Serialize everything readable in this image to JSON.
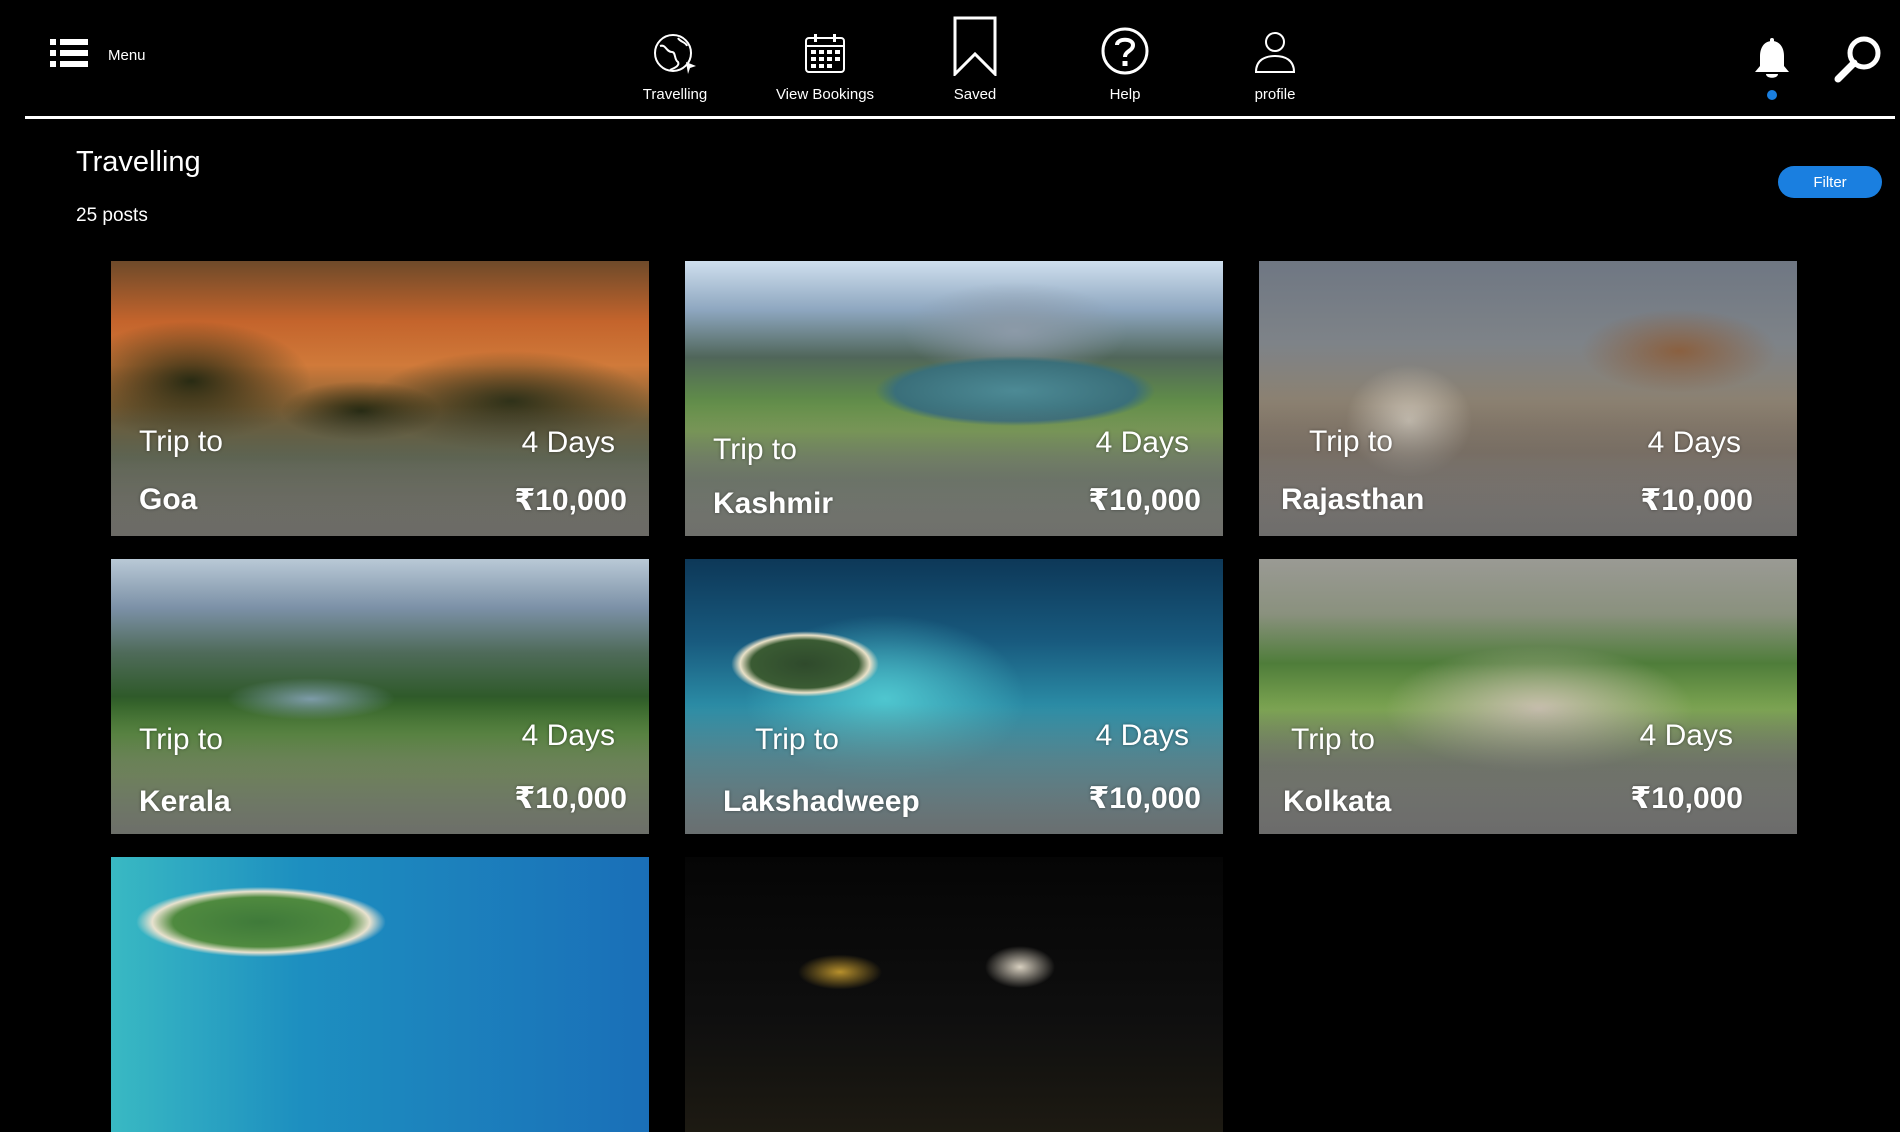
{
  "header": {
    "menu_label": "Menu",
    "nav": [
      {
        "label": "Travelling",
        "icon": "globe-icon"
      },
      {
        "label": "View Bookings",
        "icon": "calendar-icon"
      },
      {
        "label": "Saved",
        "icon": "bookmark-icon"
      },
      {
        "label": "Help",
        "icon": "help-icon"
      },
      {
        "label": "profile",
        "icon": "profile-icon"
      }
    ],
    "notification_icon": "bell-icon",
    "search_icon": "search-icon",
    "accent_color": "#1a7fe0"
  },
  "page": {
    "title": "Travelling",
    "post_count": "25 posts",
    "filter_label": "Filter"
  },
  "cards": [
    {
      "trip_label": "Trip to",
      "place": "Goa",
      "duration": "4 Days",
      "price": "₹10,000"
    },
    {
      "trip_label": "Trip to",
      "place": "Kashmir",
      "duration": "4 Days",
      "price": "₹10,000"
    },
    {
      "trip_label": "Trip to",
      "place": "Rajasthan",
      "duration": "4 Days",
      "price": "₹10,000"
    },
    {
      "trip_label": "Trip to",
      "place": "Kerala",
      "duration": "4 Days",
      "price": "₹10,000"
    },
    {
      "trip_label": "Trip to",
      "place": "Lakshadweep",
      "duration": "4 Days",
      "price": "₹10,000"
    },
    {
      "trip_label": "Trip to",
      "place": "Kolkata",
      "duration": "4 Days",
      "price": "₹10,000"
    }
  ]
}
